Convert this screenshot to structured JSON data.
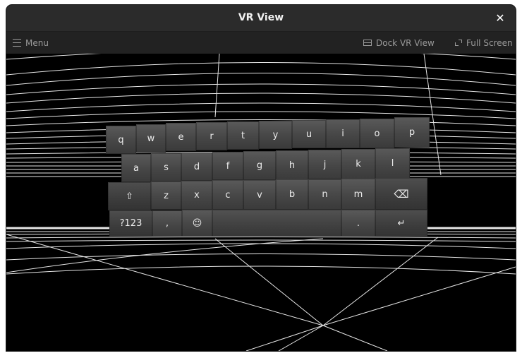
{
  "window": {
    "title": "VR View"
  },
  "toolbar": {
    "menu_label": "Menu",
    "dock_label": "Dock VR View",
    "fullscreen_label": "Full Screen"
  },
  "icons": {
    "close": "close-icon",
    "menu": "hamburger-icon",
    "dock": "dock-window-icon",
    "fullscreen": "fullscreen-icon"
  },
  "keyboard": {
    "row1": [
      "q",
      "w",
      "e",
      "r",
      "t",
      "y",
      "u",
      "i",
      "o",
      "p"
    ],
    "row2": [
      "a",
      "s",
      "d",
      "f",
      "g",
      "h",
      "j",
      "k",
      "l"
    ],
    "row3": [
      "⇧",
      "z",
      "x",
      "c",
      "v",
      "b",
      "n",
      "m",
      "⌫"
    ],
    "row4": [
      "?123",
      ",",
      "☺",
      " ",
      ".",
      "↵"
    ]
  }
}
